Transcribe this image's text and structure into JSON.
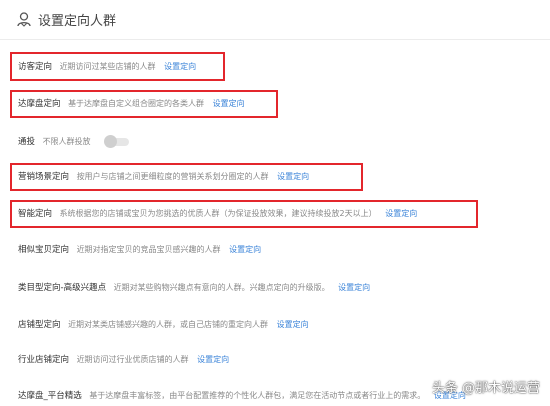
{
  "page": {
    "title": "设置定向人群"
  },
  "rows": [
    {
      "name": "访客定向",
      "desc": "近期访问过某些店铺的人群",
      "link": "设置定向"
    },
    {
      "name": "达摩盘定向",
      "desc": "基于达摩盘自定义组合圈定的各类人群",
      "link": "设置定向"
    },
    {
      "name": "通投",
      "desc": "不限人群投放"
    },
    {
      "name": "营销场景定向",
      "desc": "按用户与店铺之间更细粒度的营销关系划分圈定的人群",
      "link": "设置定向"
    },
    {
      "name": "智能定向",
      "desc": "系统根据您的店铺或宝贝为您挑选的优质人群（为保证投放效果，建议持续投放2天以上）",
      "link": "设置定向"
    },
    {
      "name": "相似宝贝定向",
      "desc": "近期对指定宝贝的竞品宝贝感兴趣的人群",
      "link": "设置定向"
    },
    {
      "name": "类目型定向-高级兴趣点",
      "desc": "近期对某些购物兴趣点有意向的人群。兴趣点定向的升级版。",
      "link": "设置定向"
    },
    {
      "name": "店铺型定向",
      "desc": "近期对某类店铺感兴趣的人群，或自己店铺的重定向人群",
      "link": "设置定向"
    },
    {
      "name": "行业店铺定向",
      "desc": "近期访问过行业优质店铺的人群",
      "link": "设置定向"
    },
    {
      "name": "达摩盘_平台精选",
      "desc": "基于达摩盘丰富标签，由平台配置推荐的个性化人群包，满足您在活动节点或者行业上的需求。",
      "link": "设置定向"
    }
  ],
  "watermark": "头条 @那木说运营",
  "colors": {
    "highlight": "#e3262c",
    "link": "#3a83d8",
    "toggle_off": "#cfcfcf"
  },
  "icons": {
    "header": "user-target-icon"
  }
}
